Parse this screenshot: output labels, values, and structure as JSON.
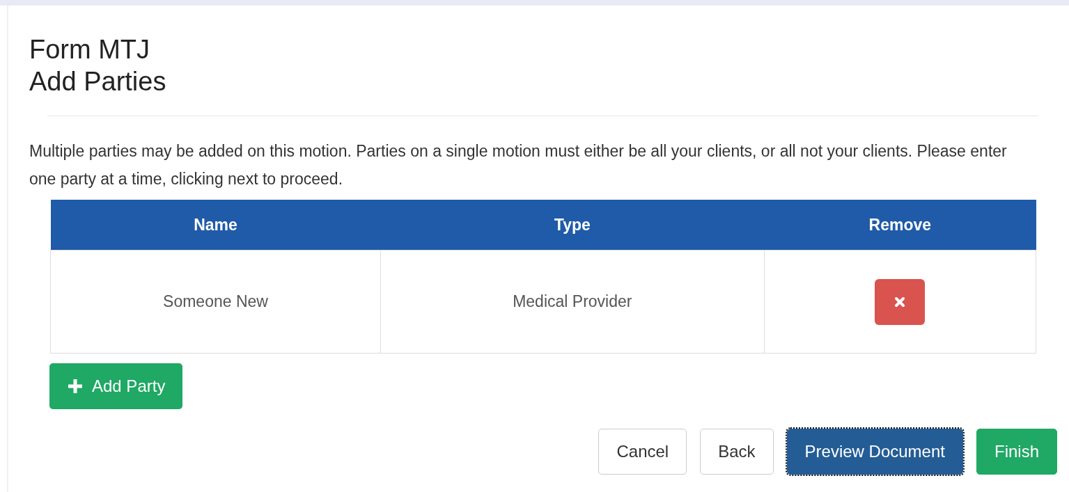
{
  "heading": {
    "line_1": "Form MTJ",
    "line_2": "Add Parties"
  },
  "instructions": "Multiple parties may be added on this motion. Parties on a single motion must either be all your clients, or all not your clients. Please enter one party at a time, clicking next to proceed.",
  "table": {
    "columns": [
      "Name",
      "Type",
      "Remove"
    ],
    "rows": [
      {
        "name": "Someone New",
        "type": "Medical Provider"
      }
    ]
  },
  "add_button": {
    "label": "Add Party"
  },
  "buttons": [
    {
      "label": "Cancel",
      "kind": "default",
      "focused": false
    },
    {
      "label": "Back",
      "kind": "default",
      "focused": false
    },
    {
      "label": "Preview Document",
      "kind": "primary",
      "focused": true
    },
    {
      "label": "Finish",
      "kind": "success",
      "focused": false
    }
  ]
}
